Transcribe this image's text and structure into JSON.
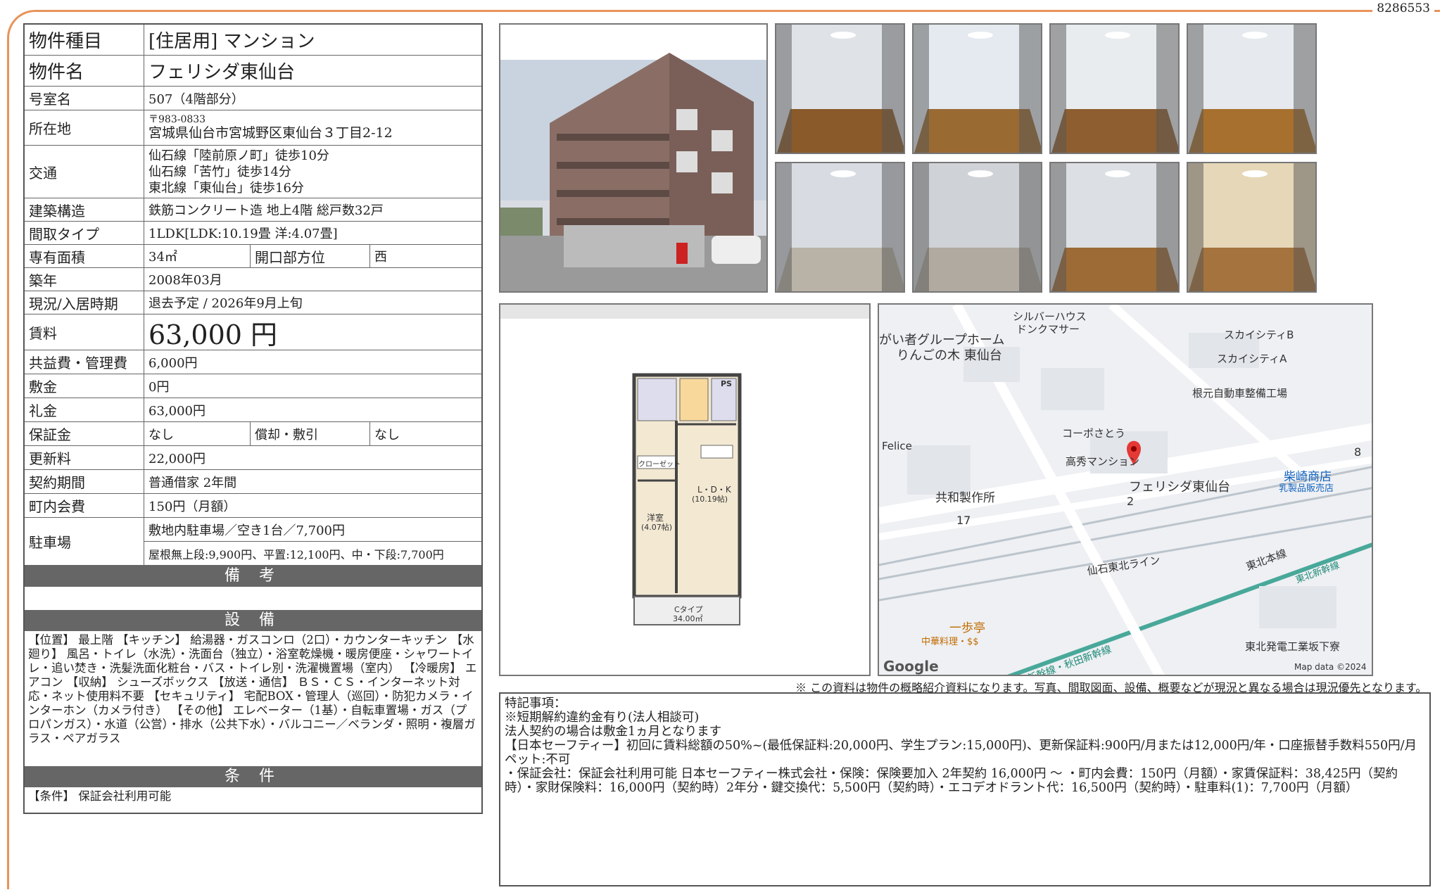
{
  "doc_id": "8286553",
  "property": {
    "type_label": "物件種目",
    "type_value": "[住居用] マンション",
    "name_label": "物件名",
    "name_value": "フェリシダ東仙台",
    "room_label": "号室名",
    "room_value": "507（4階部分）",
    "address_label": "所在地",
    "postal": "〒983-0833",
    "address_value": "宮城県仙台市宮城野区東仙台３丁目2-12",
    "access_label": "交通",
    "access": [
      "仙石線「陸前原ノ町」徒歩10分",
      "仙石線「苦竹」徒歩14分",
      "東北線「東仙台」徒歩16分"
    ],
    "structure_label": "建築構造",
    "structure_value": "鉄筋コンクリート造 地上4階 総戸数32戸",
    "layout_label": "間取タイプ",
    "layout_value": "1LDK[LDK:10.19畳 洋:4.07畳]",
    "area_label": "専有面積",
    "area_value": "34㎡",
    "direction_label": "開口部方位",
    "direction_value": "西",
    "built_label": "築年",
    "built_value": "2008年03月",
    "status_label": "現況/入居時期",
    "status_value": "退去予定 / 2026年9月上旬",
    "rent_label": "賃料",
    "rent_value": "63,000 円",
    "fee_label": "共益費・管理費",
    "fee_value": "6,000円",
    "deposit_label": "敷金",
    "deposit_value": "0円",
    "key_money_label": "礼金",
    "key_money_value": "63,000円",
    "guarantee_label": "保証金",
    "guarantee_value": "なし",
    "amort_label": "償却・敷引",
    "amort_value": "なし",
    "renewal_label": "更新料",
    "renewal_value": "22,000円",
    "contract_label": "契約期間",
    "contract_value": "普通借家 2年間",
    "town_fee_label": "町内会費",
    "town_fee_value": "150円（月額）",
    "parking_label": "駐車場",
    "parking_value": "敷地内駐車場／空き1台／7,700円",
    "parking_note": "屋根無上段:9,900円、平置:12,100円、中・下段:7,700円"
  },
  "sections": {
    "remarks_title": "備 考",
    "equipment_title": "設 備",
    "equipment_text": "【位置】 最上階 【キッチン】 給湯器・ガスコンロ（2口）・カウンターキッチン 【水廻り】 風呂・トイレ（水洗）・洗面台（独立）・浴室乾燥機・暖房便座・シャワートイレ・追い焚き・洗髪洗面化粧台・バス・トイレ別・洗濯機置場（室内） 【冷暖房】 エアコン 【収納】 シューズボックス 【放送・通信】 ＢＳ・ＣＳ・インターネット対応・ネット使用料不要 【セキュリティ】 宅配BOX・管理人（巡回）・防犯カメラ・インターホン（カメラ付き） 【その他】 エレベーター（1基）・自転車置場・ガス（プロパンガス）・水道（公営）・排水（公共下水）・バルコニー／ベランダ・照明・複層ガラス・ペアガラス",
    "conditions_title": "条 件",
    "conditions_text": "【条件】 保証会社利用可能"
  },
  "floorplan": {
    "ps": "PS",
    "closet": "クローゼット",
    "ldk": "L・D・K",
    "ldk_size": "(10.19帖)",
    "western": "洋室",
    "western_size": "(4.07帖)",
    "type": "Cタイプ",
    "area": "34.00㎡"
  },
  "map": {
    "labels": [
      "シルバーハウス",
      "ドンクマサー",
      "がい者グループホーム",
      "りんごの木 東仙台",
      "スカイシティB",
      "スカイシティA",
      "根元自動車整備工場",
      "Felice",
      "コーポさとう",
      "高秀マンション",
      "フェリシダ東仙台",
      "柴崎商店",
      "乳製品販売店",
      "共和製作所",
      "17",
      "2",
      "8",
      "仙石東北ライン",
      "東北本線",
      "東北新幹線",
      "東北新幹線・秋田新幹線",
      "一歩亭",
      "中華料理・$$",
      "東北発電工業坂下寮"
    ],
    "google": "Google",
    "map_data": "Map data ©2024"
  },
  "notice": "※ この資料は物件の概略紹介資料になります。写真、間取図面、設備、概要などが現況と異なる場合は現況優先となります。",
  "special": [
    "特記事項：",
    "※短期解約違約金有り(法人相談可)",
    "法人契約の場合は敷金1ヵ月となります",
    "【日本セーフティー】初回に賃料総額の50%~(最低保証料:20,000円、学生プラン:15,000円)、更新保証料:900円/月または12,000円/年・口座振替手数料550円/月 ペット:不可",
    "・保証会社：保証会社利用可能 日本セーフティー株式会社・保険：保険要加入 2年契約 16,000円 ～ ・町内会費：150円（月額）・家賃保証料：38,425円（契約時）・家財保険料：16,000円（契約時）2年分・鍵交換代：5,500円（契約時）・エコデオドラント代：16,500円（契約時）・駐車料(1)：7,700円（月額）"
  ]
}
